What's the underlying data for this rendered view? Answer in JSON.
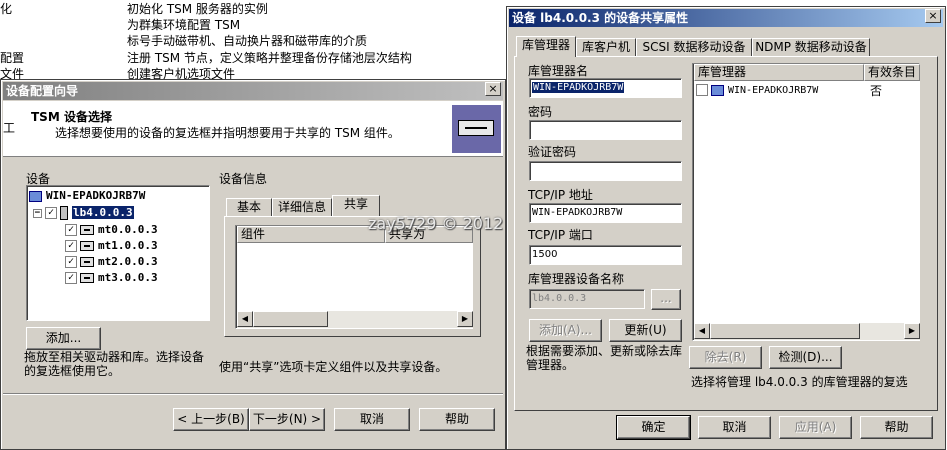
{
  "background_table": {
    "rows": [
      {
        "col1": "化",
        "col2": "初始化 TSM 服务器的实例"
      },
      {
        "col1": "",
        "col2": "为群集环境配置 TSM"
      },
      {
        "col1": "",
        "col2": "标号手动磁带机、自动换片器和磁带库的介质"
      },
      {
        "col1": "配置",
        "col2": "注册 TSM 节点，定义策略并整理备份存储池层次结构"
      },
      {
        "col1": "文件",
        "col2": "创建客户机选项文件"
      }
    ]
  },
  "wizard": {
    "title": "设备配置向导",
    "close": "×",
    "left_edge_text": "工",
    "header_title": "TSM 设备选择",
    "header_desc": "选择想要使用的设备的复选框并指明想要用于共享的 TSM 组件。",
    "devices_label": "设备",
    "tree": {
      "server": "WIN-EPADKOJRB7W",
      "library": "lb4.0.0.3",
      "drives": [
        "mt0.0.0.3",
        "mt1.0.0.3",
        "mt2.0.0.3",
        "mt3.0.0.3"
      ]
    },
    "add_button": "添加...",
    "left_desc": "拖放至相关驱动器和库。选择设备的复选框使用它。",
    "info_label": "设备信息",
    "tabs": [
      "基本",
      "详细信息",
      "共享"
    ],
    "columns": [
      "组件",
      "共享为"
    ],
    "right_desc": "使用“共享”选项卡定义组件以及共享设备。",
    "buttons": {
      "back": "< 上一步(B)",
      "next": "下一步(N) >",
      "cancel": "取消",
      "help": "帮助"
    }
  },
  "props": {
    "title": "设备 lb4.0.0.3 的设备共享属性",
    "close": "×",
    "tabs": [
      "库管理器",
      "库客户机",
      "SCSI 数据移动设备",
      "NDMP 数据移动设备"
    ],
    "fields": {
      "manager_name_label": "库管理器名",
      "manager_name_value": "WIN-EPADKOJRB7W",
      "password_label": "密码",
      "verify_label": "验证密码",
      "tcp_addr_label": "TCP/IP 地址",
      "tcp_addr_value": "WIN-EPADKOJRB7W",
      "tcp_port_label": "TCP/IP 端口",
      "tcp_port_value": "1500",
      "device_name_label": "库管理器设备名称",
      "device_name_value": "lb4.0.0.3",
      "browse": "..."
    },
    "add_button": "添加(A)...",
    "update_button": "更新(U)",
    "left_desc": "根据需要添加、更新或除去库管理器。",
    "list_columns": [
      "库管理器",
      "有效条目"
    ],
    "list_rows": [
      {
        "name": "WIN-EPADKOJRB7W",
        "valid": "否"
      }
    ],
    "remove_button": "除去(R)",
    "detect_button": "检测(D)...",
    "right_desc": "选择将管理 lb4.0.0.3 的库管理器的复选",
    "buttons": {
      "ok": "确定",
      "cancel": "取消",
      "apply": "应用(A)",
      "help": "帮助"
    }
  },
  "watermark": "zay5729 © 2012"
}
